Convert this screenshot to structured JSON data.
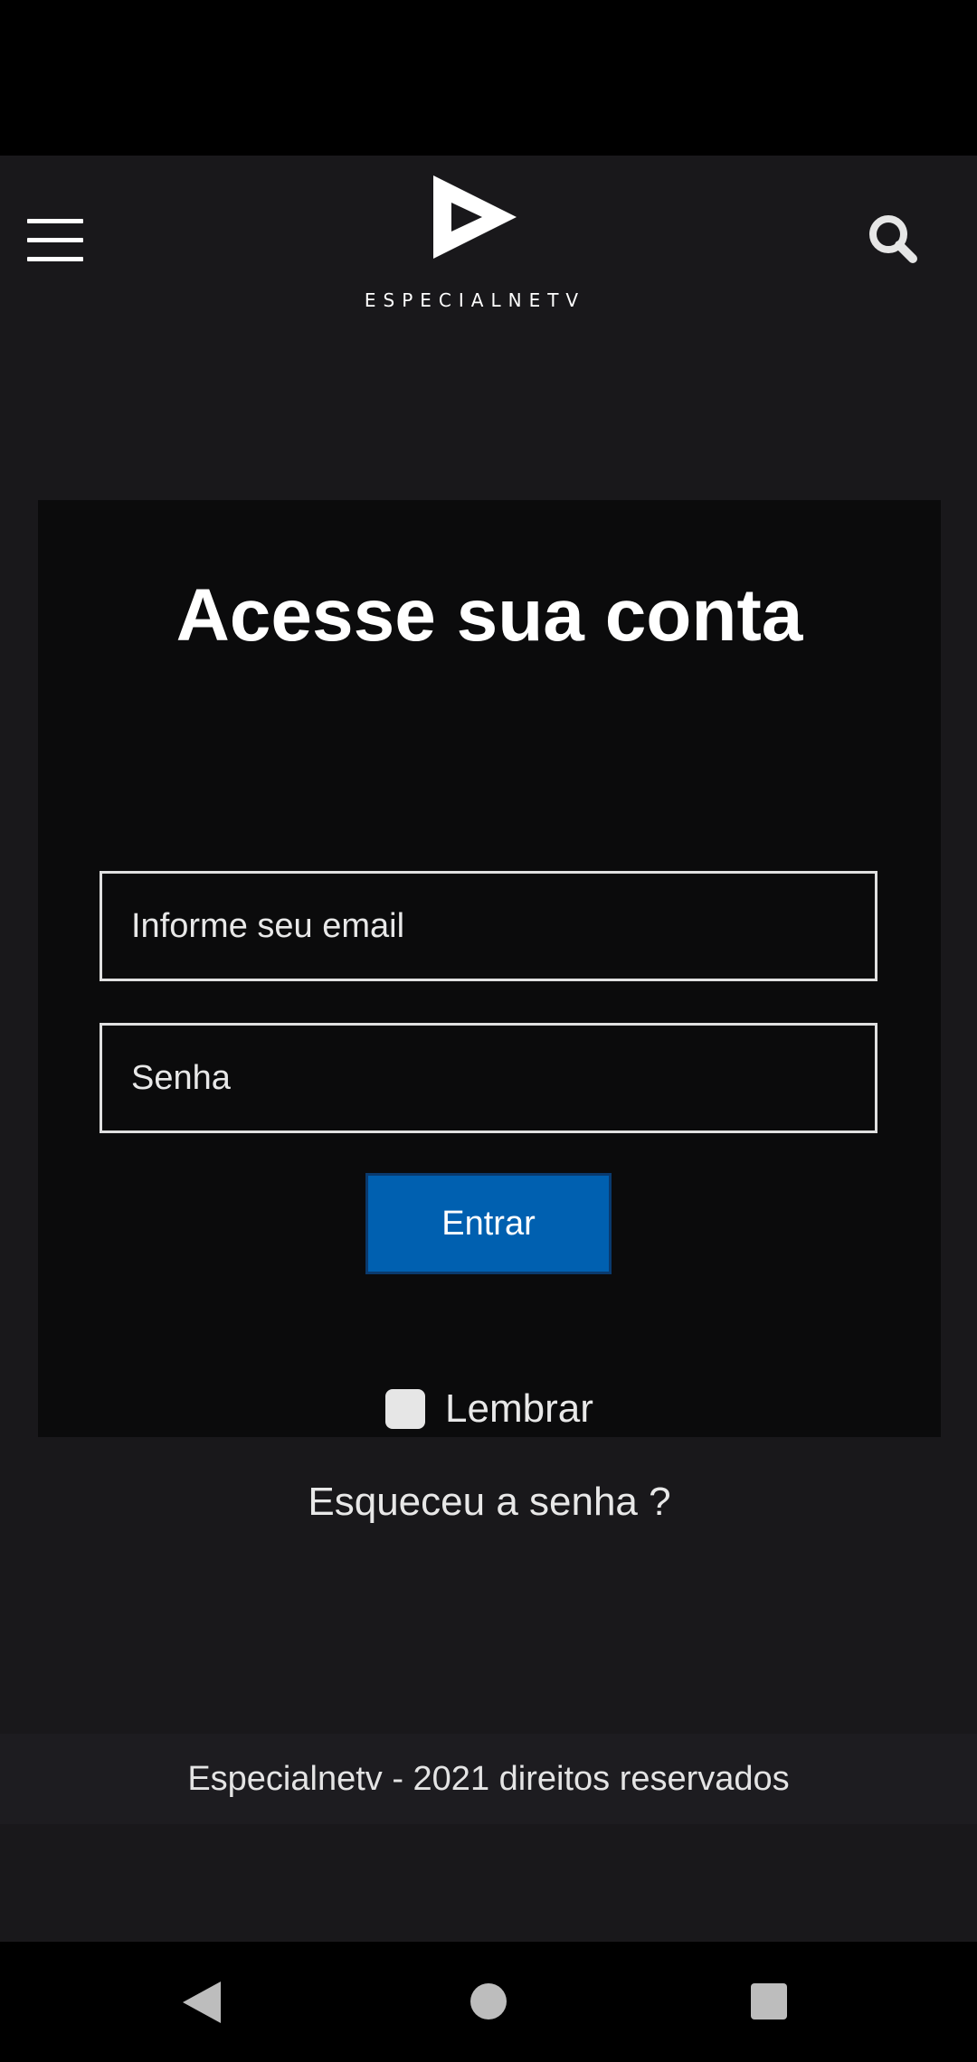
{
  "header": {
    "brand_name": "ESPECIALNETV",
    "menu_icon": "hamburger-menu-icon",
    "search_icon": "search-icon"
  },
  "login": {
    "title": "Acesse sua conta",
    "email_placeholder": "Informe seu email",
    "password_placeholder": "Senha",
    "submit_label": "Entrar",
    "remember_label": "Lembrar",
    "remember_checked": false,
    "forgot_password": "Esqueceu a senha ?"
  },
  "footer": {
    "text": "Especialnetv - 2021 direitos reservados"
  },
  "system_nav": {
    "back_icon": "back-triangle-icon",
    "home_icon": "home-circle-icon",
    "recents_icon": "recents-square-icon"
  },
  "colors": {
    "background": "#19181b",
    "card": "#0b0b0c",
    "accent_button": "#0060b0",
    "text": "#ffffff"
  }
}
